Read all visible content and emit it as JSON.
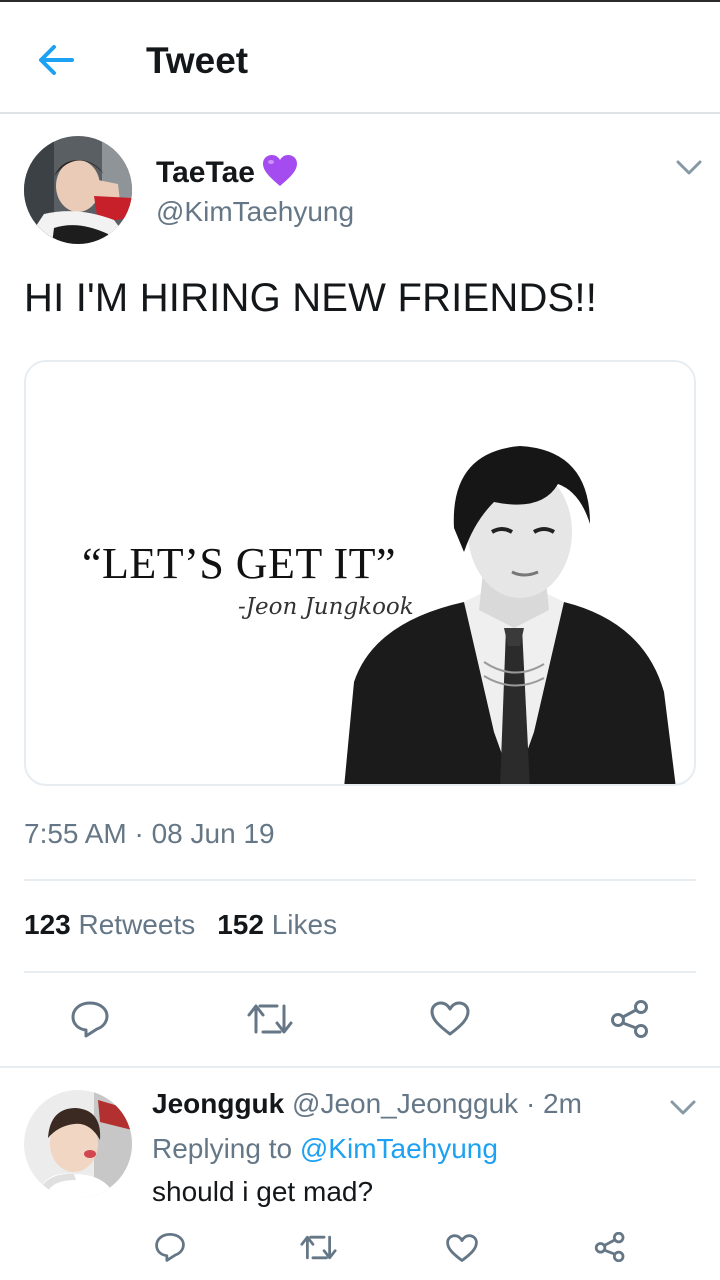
{
  "header": {
    "title": "Tweet",
    "back_icon": "arrow-left-icon",
    "accent": "#1da1f2"
  },
  "tweet": {
    "display_name": "TaeTae",
    "name_emoji": "purple-heart-icon",
    "handle": "@KimTaehyung",
    "text": "HI I'M HIRING NEW FRIENDS!!",
    "media": {
      "quote": "“LET’S GET IT”",
      "signature": "-Jeon Jungkook"
    },
    "timestamp": "7:55 AM · 08 Jun 19",
    "retweets_count": "123",
    "retweets_label": "Retweets",
    "likes_count": "152",
    "likes_label": "Likes"
  },
  "reply": {
    "display_name": "Jeongguk",
    "handle": "@Jeon_Jeongguk",
    "time": "· 2m",
    "replying_prefix": "Replying to",
    "replying_to": "@KimTaehyung",
    "text": "should i get mad?"
  },
  "colors": {
    "primary_text": "#14171a",
    "secondary_text": "#657786",
    "link": "#1da1f2",
    "divider": "#e6ecf0",
    "heart": "#a54cf0"
  },
  "actions": [
    "reply-icon",
    "retweet-icon",
    "like-icon",
    "share-icon"
  ]
}
